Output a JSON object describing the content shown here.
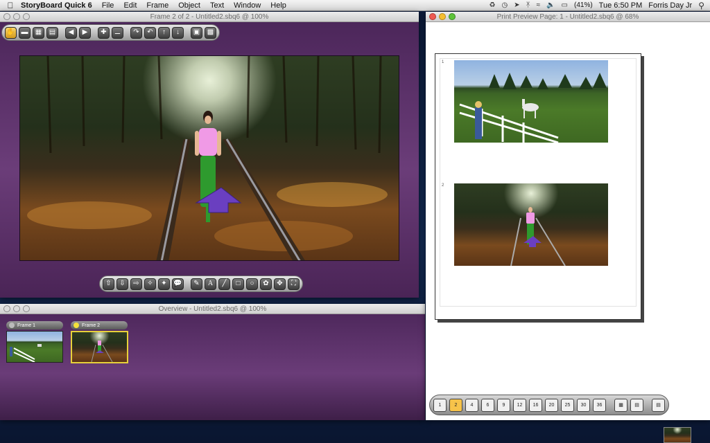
{
  "menubar": {
    "app_name": "StoryBoard Quick 6",
    "menus": [
      "File",
      "Edit",
      "Frame",
      "Object",
      "Text",
      "Window",
      "Help"
    ],
    "battery": "(41%)",
    "clock": "Tue 6:50 PM",
    "user": "Forris Day Jr"
  },
  "frame_window": {
    "title": "Frame 2 of 2 - Untitled2.sbq6 @ 100%"
  },
  "overview_window": {
    "title": "Overview - Untitled2.sbq6 @ 100%",
    "frames": [
      {
        "label": "Frame 1"
      },
      {
        "label": "Frame 2"
      }
    ]
  },
  "preview_window": {
    "title": "Print Preview Page: 1 - Untitled2.sbq6 @ 68%",
    "frame_numbers": [
      "1",
      "2"
    ],
    "layout_buttons": [
      "1",
      "2",
      "4",
      "6",
      "9",
      "12",
      "16",
      "20",
      "25",
      "30",
      "36"
    ],
    "selected_layout": "2"
  },
  "colors": {
    "window_purple": "#5a2f68",
    "selected_accent": "#f7c34a",
    "active_frame_border": "#e8d23a"
  }
}
